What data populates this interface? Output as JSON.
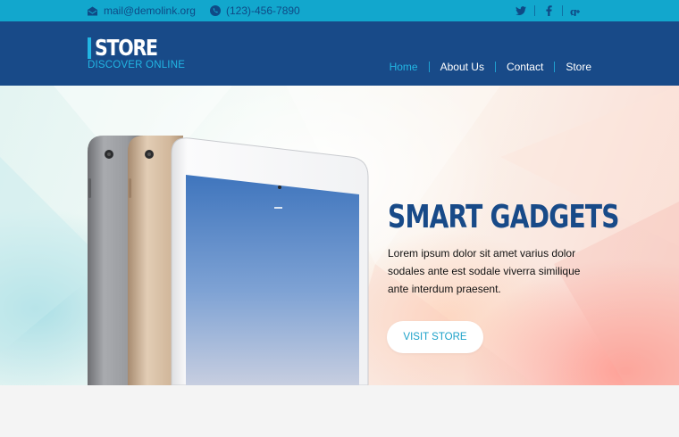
{
  "topbar": {
    "email": "mail@demolink.org",
    "phone": "(123)-456-7890",
    "social": [
      {
        "icon": "twitter-icon",
        "glyph": "🐦"
      },
      {
        "icon": "facebook-icon",
        "glyph": "f"
      },
      {
        "icon": "google-plus-icon",
        "glyph": "g+"
      }
    ]
  },
  "header": {
    "brand": "STORE",
    "tagline": "DISCOVER ONLINE",
    "nav": [
      {
        "label": "Home",
        "active": true
      },
      {
        "label": "About Us",
        "active": false
      },
      {
        "label": "Contact",
        "active": false
      },
      {
        "label": "Store",
        "active": false
      }
    ]
  },
  "hero": {
    "title": "SMART GADGETS",
    "description": "Lorem ipsum dolor sit amet varius dolor sodales ante est sodale viverra similique ante interdum praesent.",
    "button": "VISIT STORE"
  },
  "colors": {
    "topbar": "#12a7cd",
    "header": "#184a88",
    "accent": "#22b6e4"
  }
}
